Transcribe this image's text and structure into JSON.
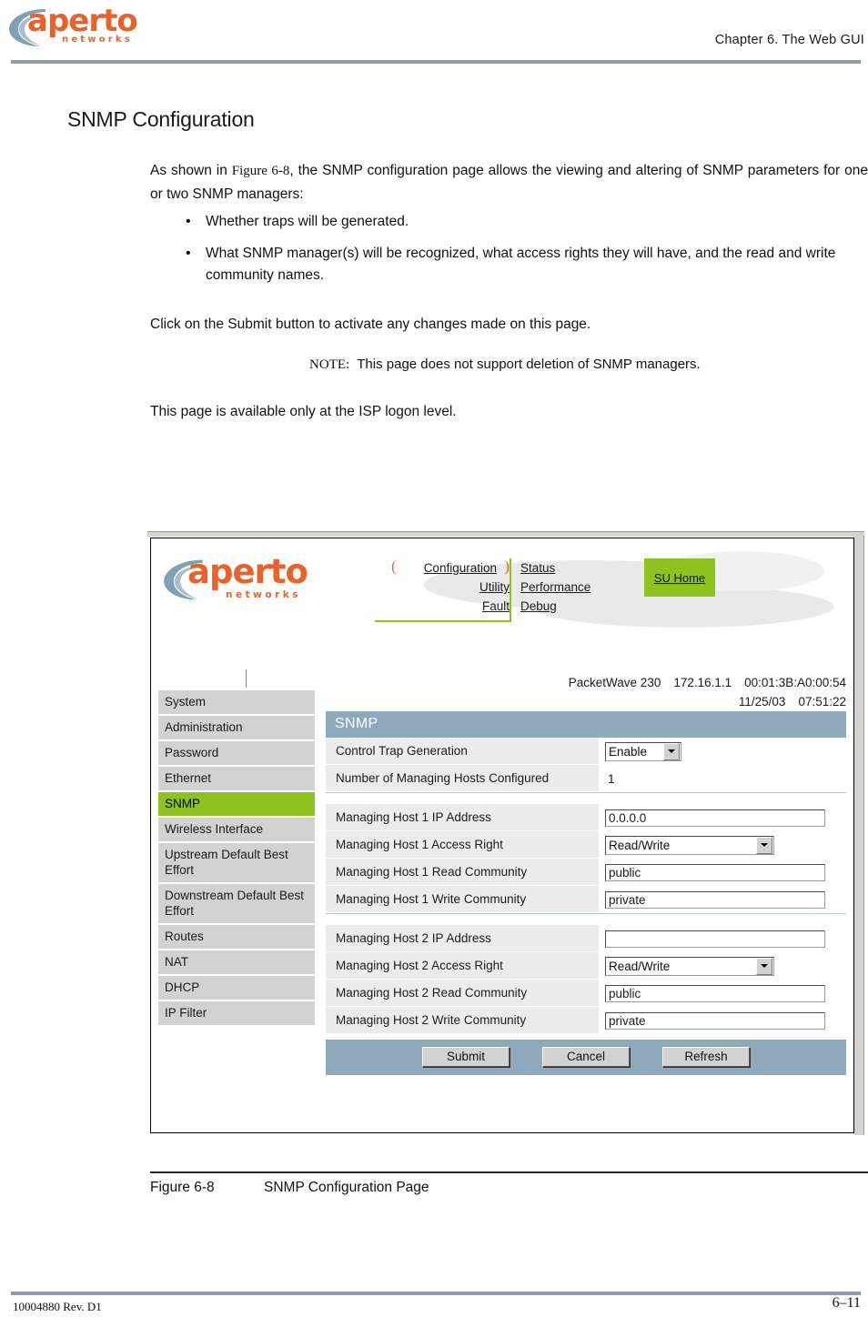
{
  "header": {
    "brand_name": "aperto",
    "brand_tagline": "networks",
    "chapter": "Chapter 6.  The Web GUI"
  },
  "content": {
    "section_title": "SNMP Configuration",
    "intro_before": "As shown in ",
    "intro_figure_ref": "Figure 6-8",
    "intro_after": ", the SNMP configuration page allows the viewing and altering of SNMP parameters for one or two SNMP managers:",
    "bullets": [
      "Whether traps will be generated.",
      "What SNMP manager(s) will be recognized, what access rights they will have, and the read and write community names."
    ],
    "submit_para": "Click on the Submit button to activate any changes made on this page.",
    "note_keyword": "NOTE:",
    "note_text": "This page does not support deletion of SNMP managers.",
    "isp_para": "This page is available only at the ISP logon level."
  },
  "gui": {
    "brand_name": "aperto",
    "brand_tagline": "networks",
    "nav_left": [
      {
        "label": "Configuration",
        "current": true
      },
      {
        "label": "Utility",
        "current": false
      },
      {
        "label": "Fault",
        "current": false
      }
    ],
    "nav_right": [
      {
        "label": "Status"
      },
      {
        "label": "Performance"
      },
      {
        "label": "Debug"
      }
    ],
    "su_home_label": "SU Home",
    "device": {
      "model": "PacketWave 230",
      "ip": "172.16.1.1",
      "mac": "00:01:3B:A0:00:54",
      "date": "11/25/03",
      "time": "07:51:22"
    },
    "sidebar": [
      {
        "label": "System",
        "active": false
      },
      {
        "label": "Administration",
        "active": false
      },
      {
        "label": "Password",
        "active": false
      },
      {
        "label": "Ethernet",
        "active": false
      },
      {
        "label": "SNMP",
        "active": true
      },
      {
        "label": "Wireless Interface",
        "active": false
      },
      {
        "label": "Upstream Default Best Effort",
        "active": false
      },
      {
        "label": "Downstream Default Best Effort",
        "active": false
      },
      {
        "label": "Routes",
        "active": false
      },
      {
        "label": "NAT",
        "active": false
      },
      {
        "label": "DHCP",
        "active": false
      },
      {
        "label": "IP Filter",
        "active": false
      }
    ],
    "form": {
      "title": "SNMP",
      "control_trap_label": "Control Trap Generation",
      "control_trap_value": "Enable",
      "num_hosts_label": "Number of Managing Hosts Configured",
      "num_hosts_value": "1",
      "host1": {
        "ip_label": "Managing Host 1 IP Address",
        "ip_value": "0.0.0.0",
        "access_label": "Managing Host 1 Access Right",
        "access_value": "Read/Write",
        "read_label": "Managing Host 1 Read Community",
        "read_value": "public",
        "write_label": "Managing Host 1 Write Community",
        "write_value": "private"
      },
      "host2": {
        "ip_label": "Managing Host 2 IP Address",
        "ip_value": "",
        "access_label": "Managing Host 2 Access Right",
        "access_value": "Read/Write",
        "read_label": "Managing Host 2 Read Community",
        "read_value": "public",
        "write_label": "Managing Host 2 Write Community",
        "write_value": "private"
      },
      "buttons": {
        "submit": "Submit",
        "cancel": "Cancel",
        "refresh": "Refresh"
      }
    }
  },
  "figure": {
    "number": "Figure 6-8",
    "caption": "SNMP Configuration Page"
  },
  "footer": {
    "doc_id": "10004880 Rev. D1",
    "page_number": "6–11"
  },
  "colors": {
    "accent_green": "#8DC21F",
    "brand_orange": "#E8622A",
    "panel_blue": "#8ea9bb",
    "rule_blue": "#8a9eaa",
    "sidebar_gray": "#d2d2d2"
  }
}
